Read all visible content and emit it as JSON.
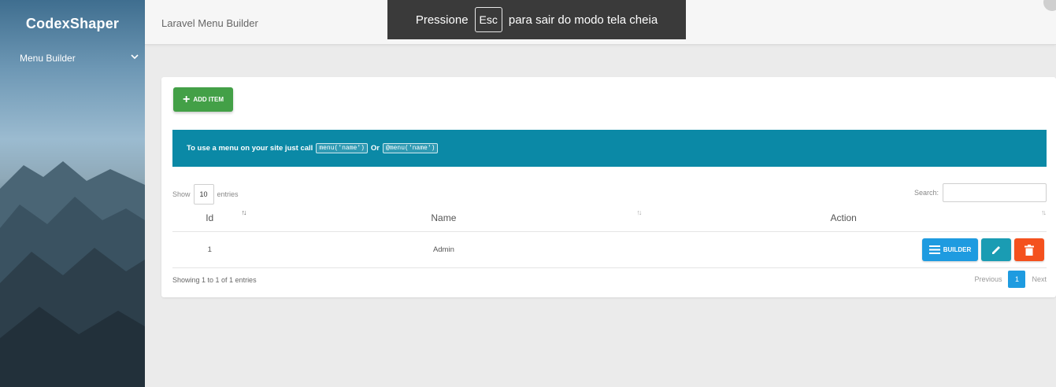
{
  "sidebar": {
    "brand": "CodexShaper",
    "items": [
      {
        "label": "Menu Builder"
      }
    ]
  },
  "header": {
    "title": "Laravel Menu Builder"
  },
  "toast": {
    "before": "Pressione",
    "key": "Esc",
    "after": "para sair do modo tela cheia"
  },
  "main": {
    "add_button_label": "ADD ITEM",
    "info": {
      "text": "To use a menu on your site just call",
      "code1": "menu('name')",
      "or": "Or",
      "code2": "@menu('name')"
    },
    "length": {
      "show": "Show",
      "value": "10",
      "entries": "entries"
    },
    "search": {
      "label": "Search:"
    },
    "table": {
      "columns": [
        "Id",
        "Name",
        "Action"
      ],
      "rows": [
        {
          "id": "1",
          "name": "Admin",
          "builder_label": "BUILDER"
        }
      ]
    },
    "info_footer": "Showing 1 to 1 of 1 entries",
    "pagination": {
      "previous": "Previous",
      "current": "1",
      "next": "Next"
    }
  },
  "colors": {
    "add_button": "#43a047",
    "info_bar": "#0b89a6",
    "builder_button": "#1e9be0",
    "edit_button": "#1a9cb3",
    "delete_button": "#f4511e"
  },
  "icons": [
    "plus-icon",
    "chevron-down-icon",
    "sort-icon",
    "menu-icon",
    "pencil-icon",
    "trash-icon"
  ]
}
